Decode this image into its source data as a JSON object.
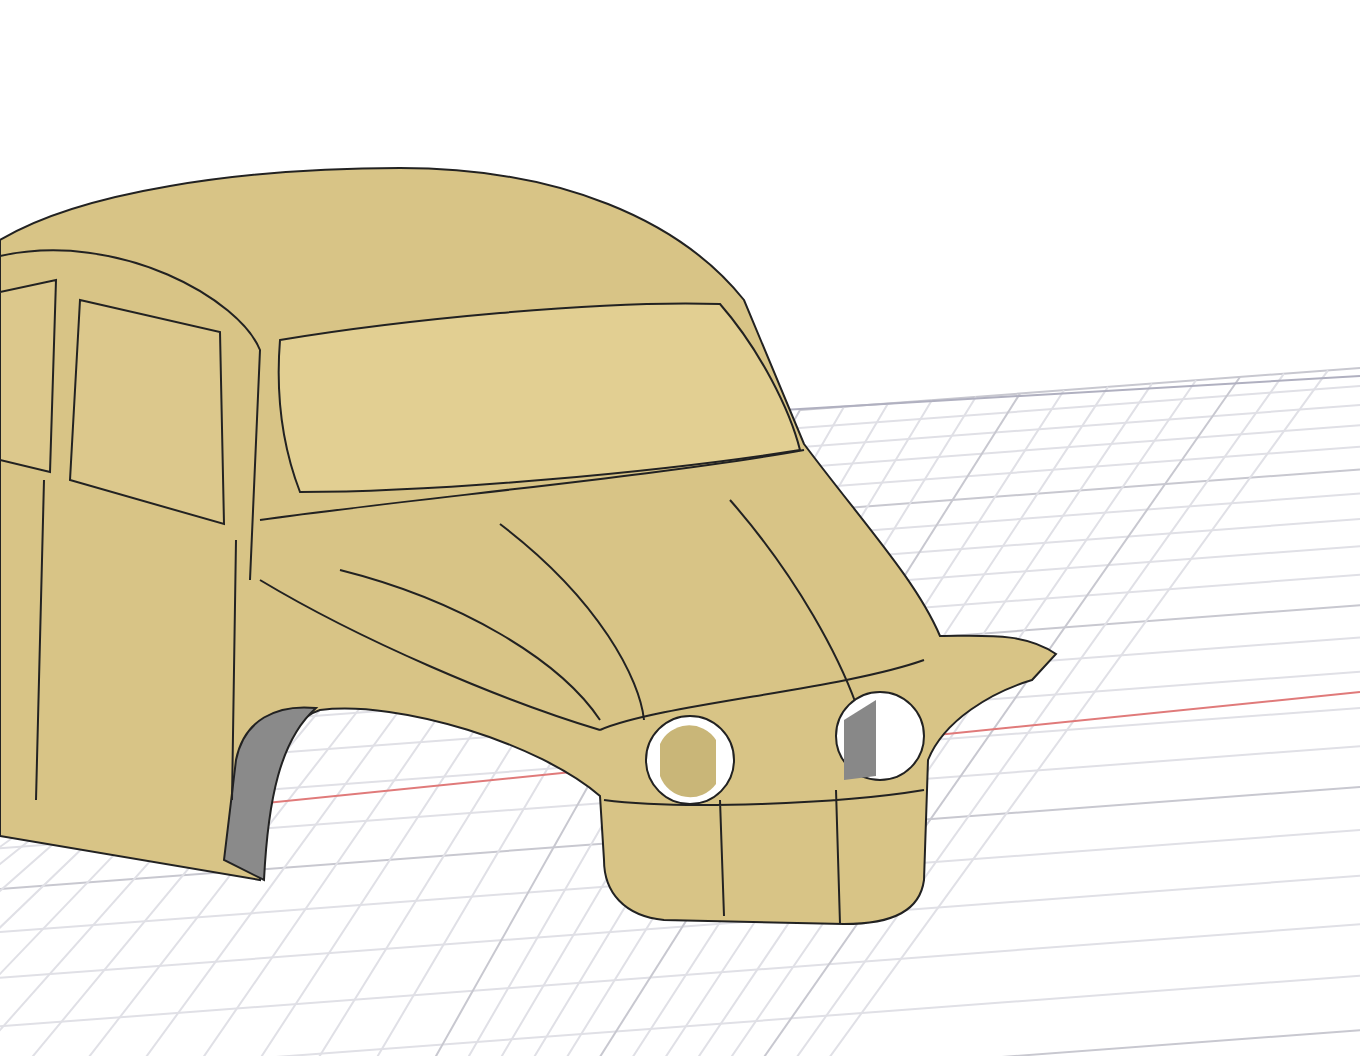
{
  "viewport": {
    "grid_visible": true,
    "model": {
      "kind": "car-body"
    }
  }
}
